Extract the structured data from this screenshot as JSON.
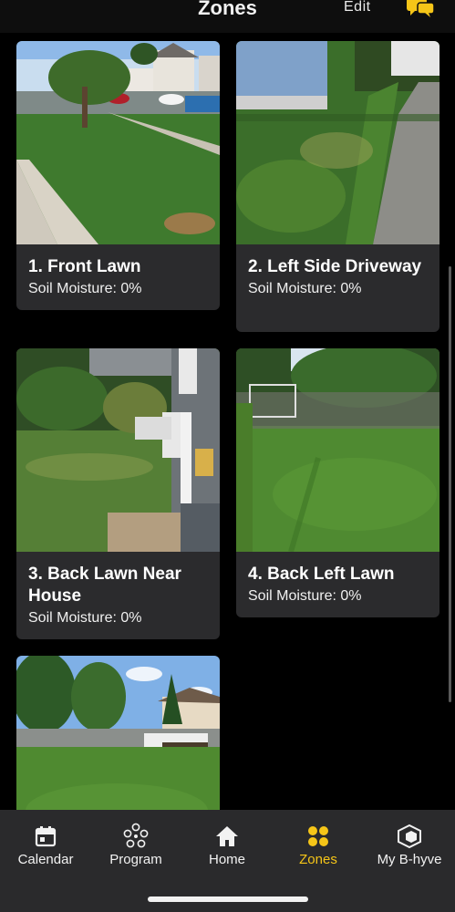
{
  "header": {
    "title": "Zones",
    "edit_label": "Edit",
    "chat_icon": "chat-bubbles-icon",
    "accent": "#f5c518"
  },
  "zones": [
    {
      "name": "1. Front Lawn",
      "moisture": "Soil Moisture: 0%"
    },
    {
      "name": "2. Left Side Driveway",
      "moisture": "Soil Moisture: 0%"
    },
    {
      "name": "3. Back Lawn Near House",
      "moisture": "Soil Moisture: 0%"
    },
    {
      "name": "4. Back Left Lawn",
      "moisture": "Soil Moisture: 0%"
    },
    {
      "name": "",
      "moisture": ""
    }
  ],
  "tabs": [
    {
      "label": "Calendar",
      "icon": "calendar-icon",
      "active": false
    },
    {
      "label": "Program",
      "icon": "program-dial-icon",
      "active": false
    },
    {
      "label": "Home",
      "icon": "home-icon",
      "active": false
    },
    {
      "label": "Zones",
      "icon": "zones-icon",
      "active": true
    },
    {
      "label": "My B-hyve",
      "icon": "b-hyve-hex-icon",
      "active": false
    }
  ],
  "colors": {
    "background": "#000000",
    "card": "#2b2b2d",
    "tabbar": "#2a2a2c",
    "active_tab": "#f5c518"
  }
}
